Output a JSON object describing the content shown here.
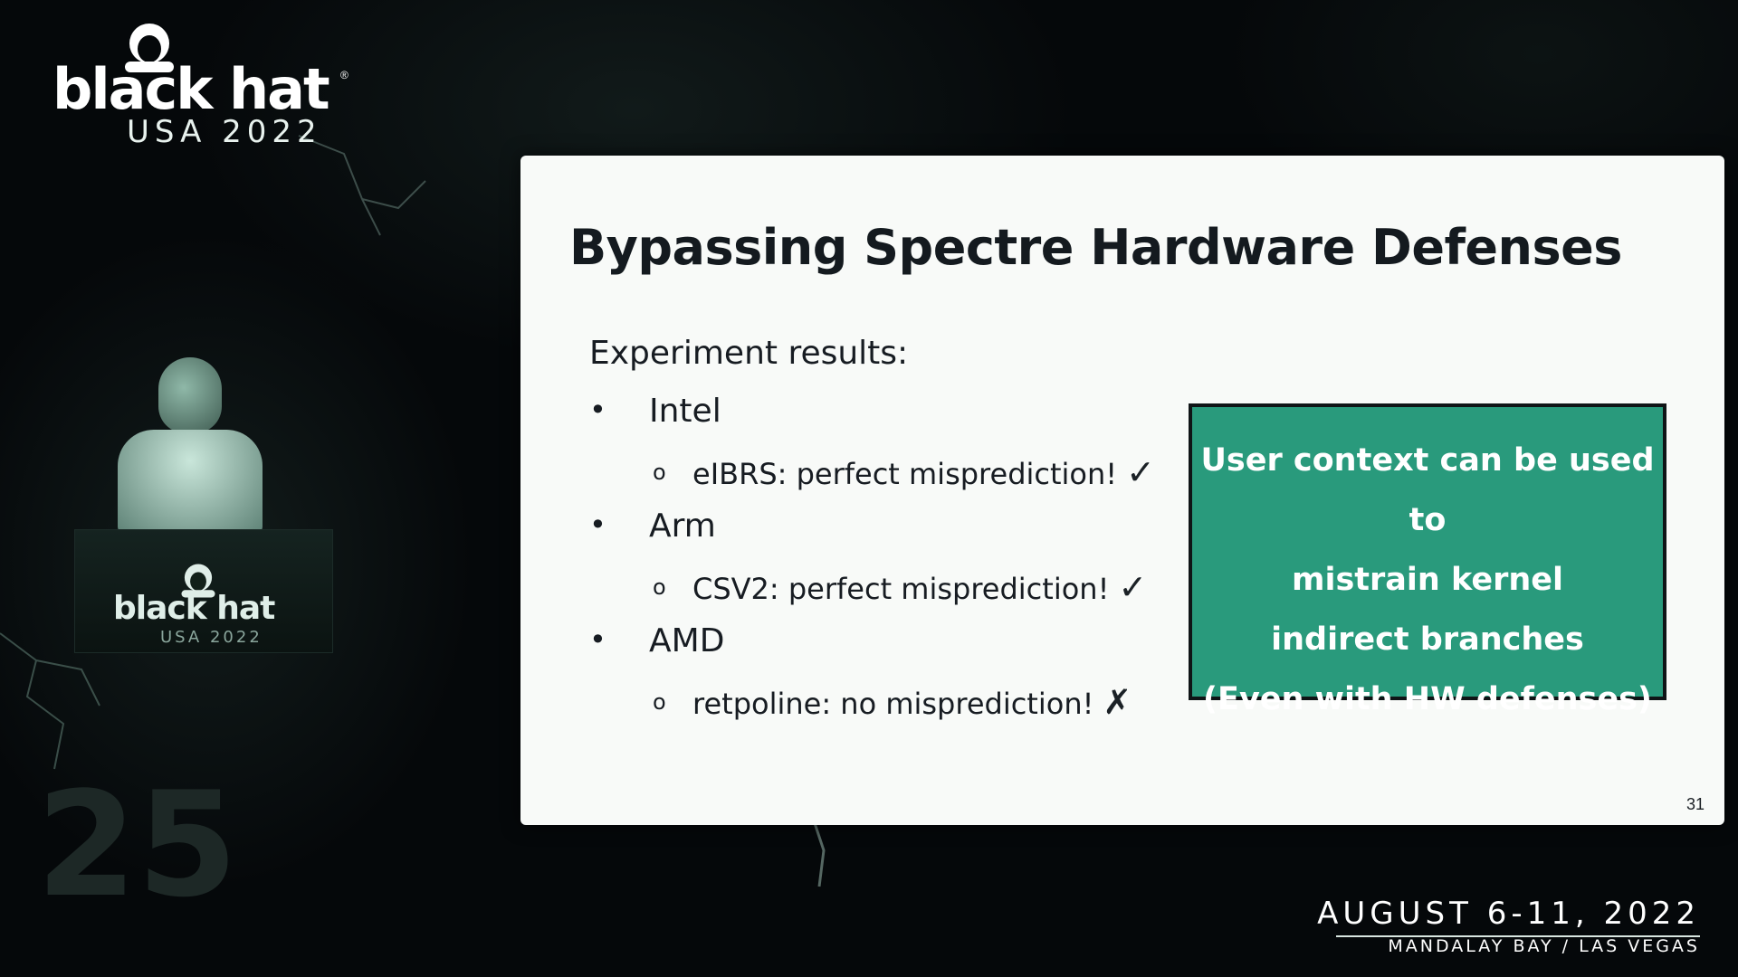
{
  "branding": {
    "logo_word": "black hat",
    "logo_sub": "USA 2022",
    "podium_word": "black hat",
    "podium_sub": "USA 2022",
    "event_date": "AUGUST 6-11, 2022",
    "event_venue": "MANDALAY BAY / LAS VEGAS"
  },
  "slide": {
    "title": "Bypassing Spectre Hardware Defenses",
    "intro": "Experiment results:",
    "items": [
      {
        "bullet": "•",
        "vendor": "Intel",
        "sub_bullet": "o",
        "detail": "eIBRS: perfect misprediction!",
        "mark": "✓"
      },
      {
        "bullet": "•",
        "vendor": "Arm",
        "sub_bullet": "o",
        "detail": "CSV2: perfect misprediction!",
        "mark": "✓"
      },
      {
        "bullet": "•",
        "vendor": "AMD",
        "sub_bullet": "o",
        "detail": "retpoline: no misprediction!",
        "mark": "✗"
      }
    ],
    "callout_lines": [
      "User context can be used to",
      "mistrain kernel",
      "indirect branches",
      "(Even with HW defenses)"
    ],
    "callout_color": "#299a7c",
    "page_number": "31"
  },
  "icons": {
    "check": "check-icon",
    "cross": "cross-icon",
    "logo": "black-hat-logo-icon"
  }
}
